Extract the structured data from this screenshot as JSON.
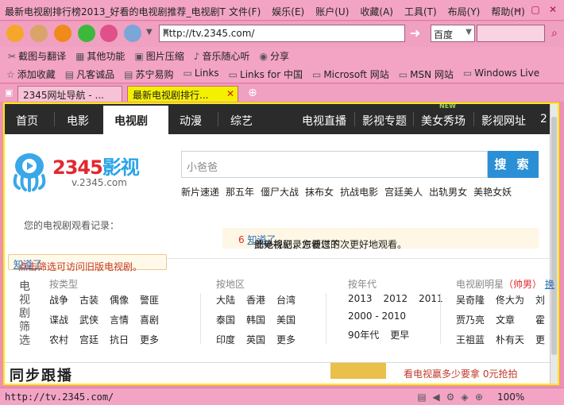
{
  "window": {
    "title": "最新电视剧排行榜2013_好看的电视剧推荐_电视剧T",
    "menu": [
      "文件(F)",
      "娱乐(E)",
      "账户(U)",
      "收藏(A)",
      "工具(T)",
      "布局(Y)",
      "帮助(H)"
    ]
  },
  "navbar": {
    "address": "http://tv.2345.com/",
    "search_engine": "百度"
  },
  "tools": [
    "截图与翻译",
    "其他功能",
    "图片压缩",
    "音乐随心听",
    "分享"
  ],
  "favorites": [
    "添加收藏",
    "凡客诚品",
    "苏宁易购",
    "Links",
    "Links for 中国",
    "Microsoft 网站",
    "MSN 网站",
    "Windows Live"
  ],
  "tabs": [
    "2345网址导航 - ...",
    "最新电视剧排行..."
  ],
  "site": {
    "nav": [
      "首页",
      "电影",
      "电视剧",
      "动漫",
      "综艺"
    ],
    "nav_right": [
      "电视直播",
      "影视专题",
      "美女秀场",
      "影视网址",
      "2"
    ],
    "new_badge": "NEW",
    "logo_num": "2345",
    "logo_cn": "影视",
    "logo_url": "v.2345.com",
    "search_placeholder": "小爸爸",
    "search_button": "搜 索",
    "hot_keywords": [
      "新片速递",
      "那五年",
      "僵尸大战",
      "抹布女",
      "抗战电影",
      "宫廷美人",
      "出轨男女",
      "美艳女妖"
    ],
    "history_label": "您的电视剧观看记录：",
    "history_note_pre": "此处将记录您看过的",
    "history_note_num": "6",
    "history_note_post": "部电视剧，方便您下次更好地观看。",
    "history_note_link": "知道了",
    "filter_tip": "点击筛选可访问旧版电视剧。",
    "filter_tip_link": "知道了",
    "filter_label": "电视剧筛选",
    "by_type": {
      "title": "按类型",
      "items": [
        "战争",
        "古装",
        "偶像",
        "警匪",
        "谍战",
        "武侠",
        "言情",
        "喜剧",
        "农村",
        "宫廷",
        "抗日",
        "更多"
      ]
    },
    "by_region": {
      "title": "按地区",
      "items": [
        "大陆",
        "香港",
        "台湾",
        "泰国",
        "韩国",
        "美国",
        "印度",
        "英国",
        "更多"
      ]
    },
    "by_year": {
      "title": "按年代",
      "items": [
        "2013",
        "2012",
        "2011",
        "2000 - 2010",
        "",
        "",
        "90年代",
        "更早",
        ""
      ]
    },
    "stars": {
      "title_pre": "电视剧明星",
      "title_tag": "（帅男）",
      "title_link": "换",
      "items": [
        "吴奇隆",
        "佟大为",
        "刘",
        "贾乃亮",
        "文章",
        "霍",
        "王祖蓝",
        "朴有天",
        "更"
      ]
    },
    "bottom_heading": "同步跟播",
    "bottom_promo": "看电视赢多少要拿 0元抢拍"
  },
  "status": {
    "url": "http://tv.2345.com/",
    "zoom": "100%"
  }
}
